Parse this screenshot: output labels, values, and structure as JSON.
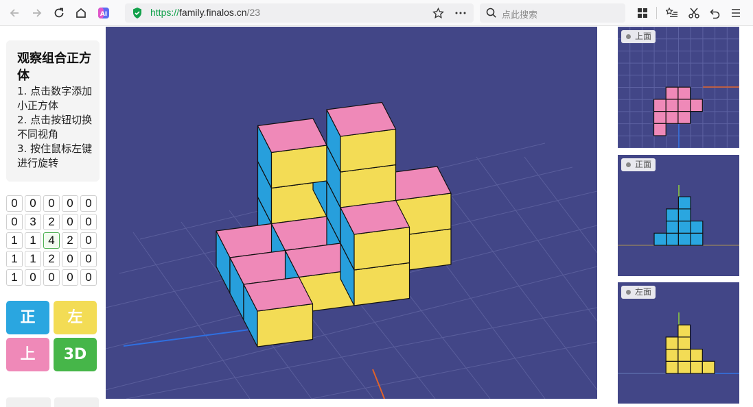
{
  "browser": {
    "url_scheme": "https://",
    "url_host": "family.finalos.cn",
    "url_path": "/23",
    "search_placeholder": "点此搜索"
  },
  "instructions": {
    "title": "观察组合正方体",
    "steps": [
      "1. 点击数字添加小正方体",
      "2. 点击按钮切换不同视角",
      "3. 按住鼠标左键进行旋转"
    ]
  },
  "grid": [
    [
      "0",
      "0",
      "0",
      "0",
      "0"
    ],
    [
      "0",
      "3",
      "2",
      "0",
      "0"
    ],
    [
      "1",
      "1",
      "4",
      "2",
      "0"
    ],
    [
      "1",
      "1",
      "2",
      "0",
      "0"
    ],
    [
      "1",
      "0",
      "0",
      "0",
      "0"
    ]
  ],
  "active_cell": {
    "row": 2,
    "col": 2
  },
  "view_buttons": {
    "front": "正",
    "left": "左",
    "top": "上",
    "three_d": "3D"
  },
  "side_views": {
    "top_label": "上面",
    "front_label": "正面",
    "left_label": "左面"
  },
  "colors": {
    "background": "#424687",
    "top_face": "#ef89b8",
    "front_face": "#f3dc55",
    "side_face": "#279fdc",
    "front_button": "#2aa6e0",
    "left_button": "#f3dc55",
    "top_button": "#ef89b8",
    "three_d_button": "#46b649"
  }
}
